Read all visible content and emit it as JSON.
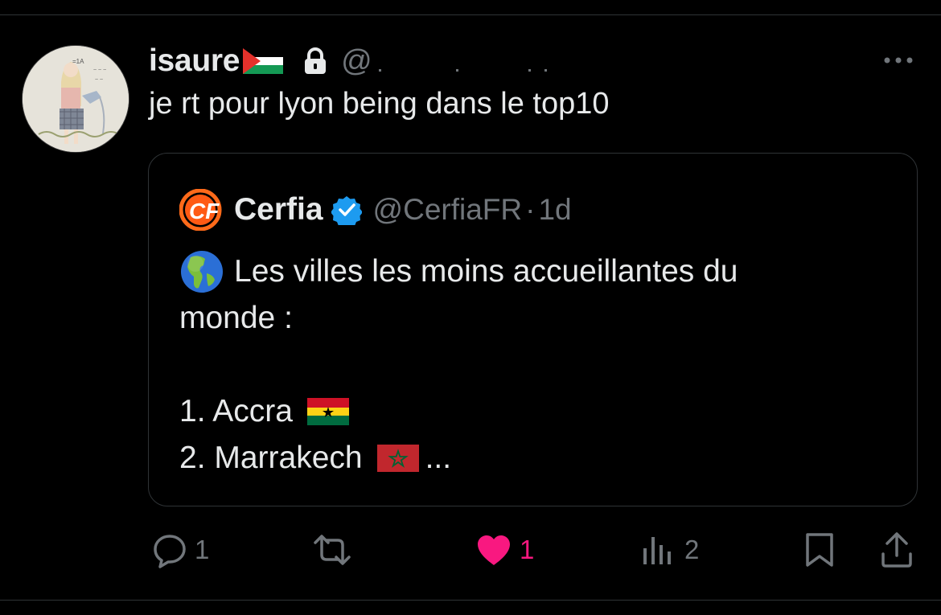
{
  "tweet": {
    "display_name": "isaure",
    "handle": "@​",
    "text": "je rt pour lyon being dans le top10"
  },
  "quoted": {
    "display_name": "Cerfia",
    "handle": "@CerfiaFR",
    "separator": "·",
    "time": "1d",
    "line1": "Les villes les moins accueillantes du",
    "line2": "monde :",
    "item1": "1. Accra",
    "item2": "2. Marrakech",
    "ellipsis": "..."
  },
  "actions": {
    "replies": "1",
    "likes": "1",
    "views": "2"
  },
  "colors": {
    "background": "#000000",
    "text": "#e7e9ea",
    "muted": "#71767b",
    "like": "#f91880",
    "verified": "#1d9bf0",
    "border": "#2f3336"
  },
  "icons": [
    "palestine-flag-icon",
    "lock-icon",
    "more-icon",
    "cerfia-logo",
    "verified-badge-icon",
    "globe-americas-icon",
    "ghana-flag-icon",
    "morocco-flag-icon",
    "reply-icon",
    "retweet-icon",
    "heart-icon",
    "views-icon",
    "bookmark-icon",
    "share-icon"
  ]
}
